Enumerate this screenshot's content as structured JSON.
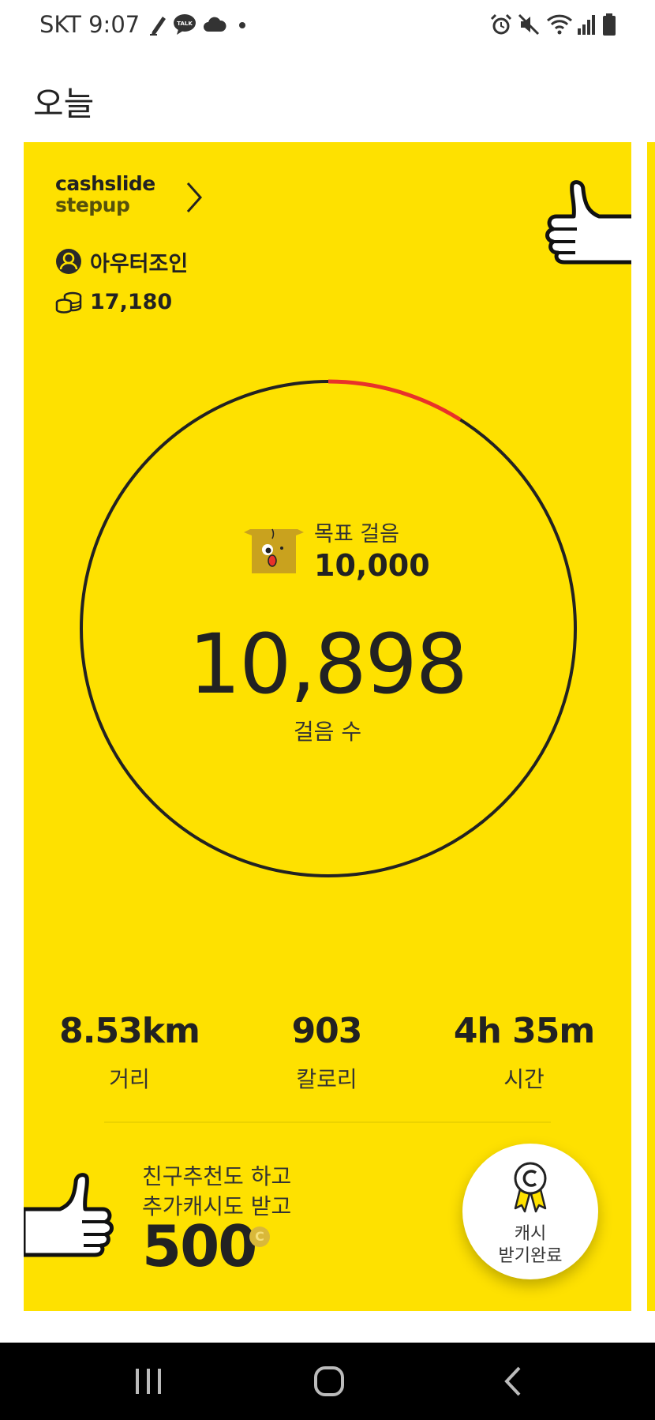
{
  "status_bar": {
    "carrier_time": "SKT 9:07",
    "left_icons": [
      "pen-icon",
      "kakaotalk-icon",
      "cloud-icon",
      "dot-icon"
    ],
    "kakaotalk_badge": "TALK",
    "right_icons": [
      "alarm-icon",
      "mute-icon",
      "wifi-icon",
      "signal-icon",
      "battery-icon"
    ]
  },
  "page": {
    "title": "오늘"
  },
  "card": {
    "background": "#FEE100",
    "brand": {
      "line1": "cashslide",
      "line2": "stepup"
    },
    "user": {
      "name": "아우터조인",
      "icon": "user-circle-icon"
    },
    "coins": {
      "amount": "17,180",
      "icon": "coin-stack-icon"
    },
    "goal": {
      "label": "목표 걸음",
      "value": "10,000"
    },
    "steps": {
      "count": "10,898",
      "label": "걸음 수",
      "progress_fraction": 1.0898,
      "over_goal_color": "#E8322A"
    },
    "stats": [
      {
        "value": "8.53km",
        "label": "거리"
      },
      {
        "value": "903",
        "label": "칼로리"
      },
      {
        "value": "4h 35m",
        "label": "시간"
      }
    ],
    "promo": {
      "line1": "친구추천도 하고",
      "line2": "추가캐시도 받고",
      "value": "500",
      "coin_symbol": "C"
    },
    "cash_button": {
      "line1": "캐시",
      "line2": "받기완료",
      "icon": "medal-icon"
    }
  },
  "nav_bar": {
    "icons": [
      "recent-apps-icon",
      "home-icon",
      "back-icon"
    ]
  }
}
